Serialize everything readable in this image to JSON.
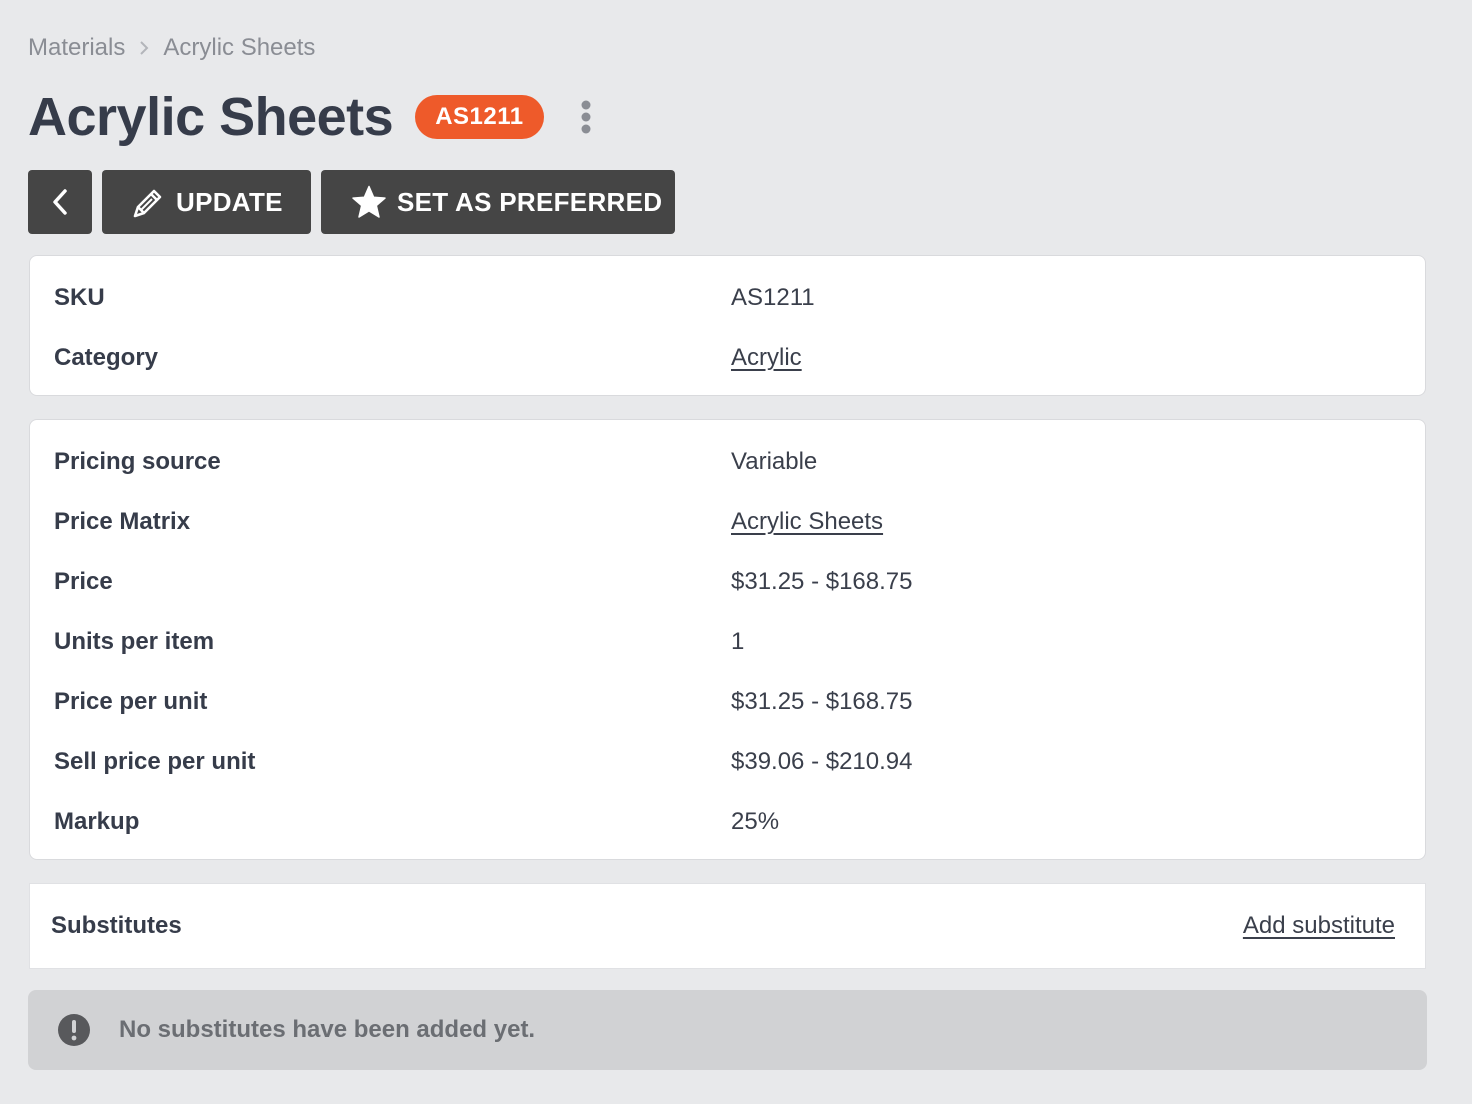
{
  "breadcrumb": {
    "items": [
      "Materials",
      "Acrylic Sheets"
    ],
    "separator_icon": "chevron-right-icon"
  },
  "header": {
    "title": "Acrylic Sheets",
    "badge": "AS1211",
    "badge_color": "#ee5a2a",
    "more_icon": "kebab-vertical-icon"
  },
  "toolbar": {
    "back_icon": "chevron-left-icon",
    "update_label": "UPDATE",
    "update_icon": "pencil-icon",
    "preferred_label": "SET AS PREFERRED",
    "preferred_icon": "star-icon",
    "button_color": "#454545"
  },
  "identity": [
    {
      "label": "SKU",
      "value": "AS1211",
      "link": false
    },
    {
      "label": "Category",
      "value": "Acrylic",
      "link": true
    }
  ],
  "pricing": [
    {
      "label": "Pricing source",
      "value": "Variable",
      "link": false
    },
    {
      "label": "Price Matrix",
      "value": "Acrylic Sheets",
      "link": true
    },
    {
      "label": "Price",
      "value": "$31.25 - $168.75",
      "link": false
    },
    {
      "label": "Units per item",
      "value": "1",
      "link": false
    },
    {
      "label": "Price per unit",
      "value": "$31.25 - $168.75",
      "link": false
    },
    {
      "label": "Sell price per unit",
      "value": "$39.06 - $210.94",
      "link": false
    },
    {
      "label": "Markup",
      "value": "25%",
      "link": false
    }
  ],
  "substitutes": {
    "title": "Substitutes",
    "add_label": "Add substitute",
    "empty_icon": "exclamation-circle-icon",
    "empty_message": "No substitutes have been added yet."
  }
}
